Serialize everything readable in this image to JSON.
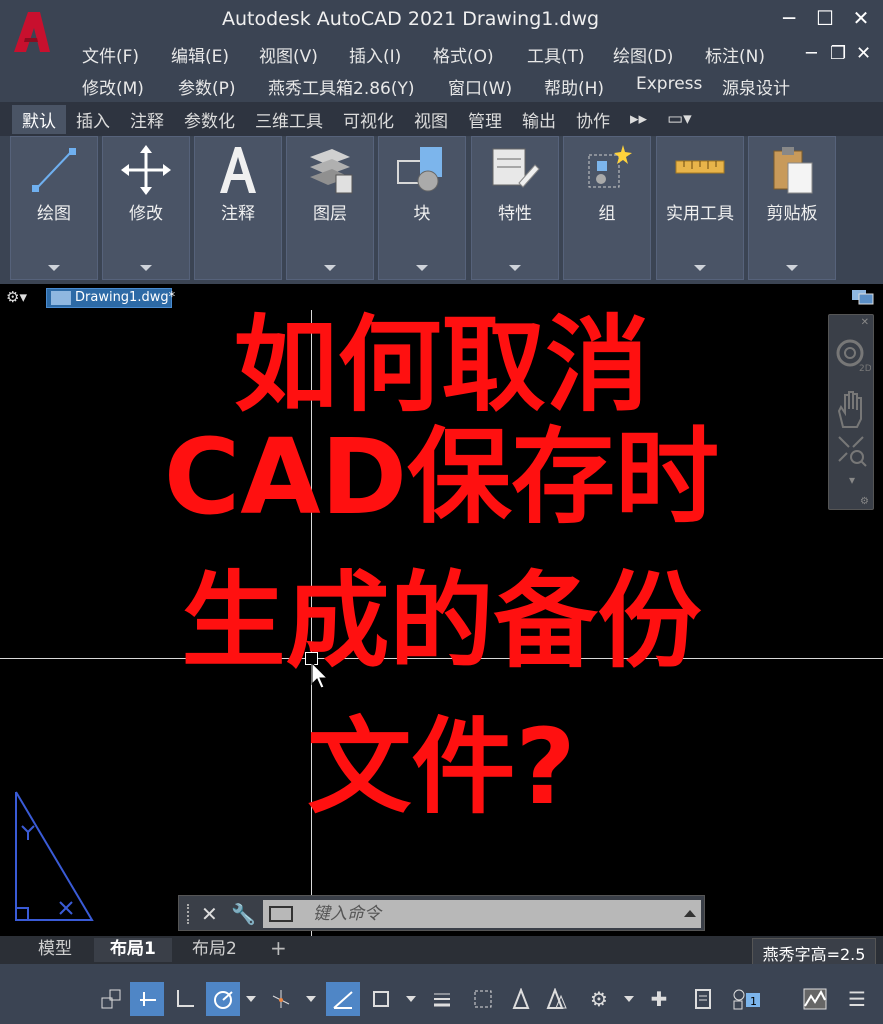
{
  "window": {
    "title": "Autodesk AutoCAD 2021    Drawing1.dwg",
    "minimize": "─",
    "maximize": "☐",
    "close": "✕"
  },
  "menu": {
    "row1": [
      "文件(F)",
      "编辑(E)",
      "视图(V)",
      "插入(I)",
      "格式(O)",
      "工具(T)",
      "绘图(D)",
      "标注(N)"
    ],
    "row2": [
      "修改(M)",
      "参数(P)",
      "燕秀工具箱2.86(Y)",
      "窗口(W)",
      "帮助(H)",
      "Express",
      "源泉设计"
    ]
  },
  "ribbon": {
    "tabs": [
      "默认",
      "插入",
      "注释",
      "参数化",
      "三维工具",
      "可视化",
      "视图",
      "管理",
      "输出",
      "协作"
    ],
    "active_tab": "默认",
    "panels": [
      "绘图",
      "修改",
      "注释",
      "图层",
      "块",
      "特性",
      "组",
      "实用工具",
      "剪贴板"
    ]
  },
  "file_tab": {
    "name": "Drawing1.dwg*"
  },
  "overlay": {
    "line1": "如何取消",
    "line2": "CAD保存时",
    "line3": "生成的备份",
    "line4": "文件?"
  },
  "command_line": {
    "placeholder": "键入命令"
  },
  "layout_tabs": {
    "model": "模型",
    "layout1": "布局1",
    "layout2": "布局2",
    "add": "+"
  },
  "status": {
    "text_height": "燕秀字高=2.5"
  },
  "colors": {
    "overlay_red": "#ff1010",
    "accent_blue": "#4f86c6",
    "logo_red": "#c8102e"
  }
}
